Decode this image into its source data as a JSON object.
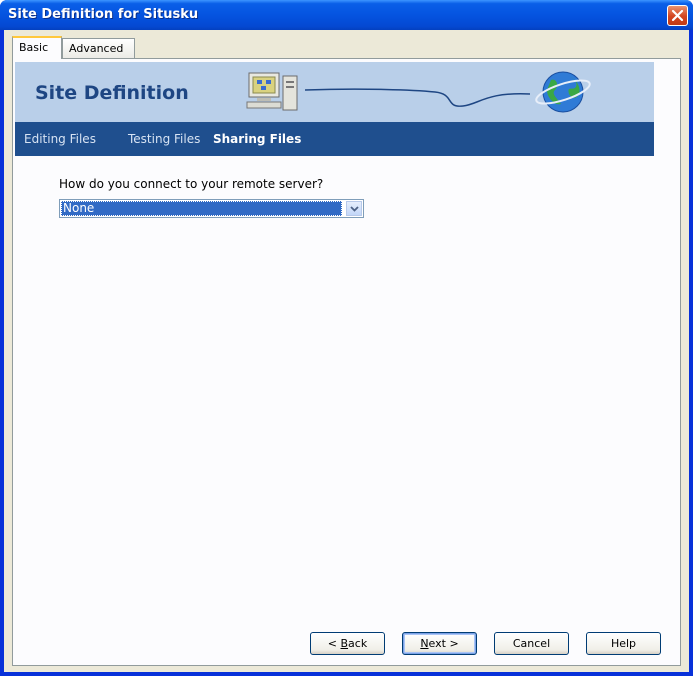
{
  "window": {
    "title": "Site Definition for Situsku"
  },
  "tabs": [
    {
      "label": "Basic"
    },
    {
      "label": "Advanced"
    }
  ],
  "banner": {
    "title": "Site Definition"
  },
  "subnav": {
    "items": [
      {
        "label": "Editing Files"
      },
      {
        "label": "Testing Files"
      },
      {
        "label": "Sharing Files"
      }
    ],
    "active": "Sharing Files"
  },
  "form": {
    "question": "How do you connect to your remote server?",
    "connection_value": "None"
  },
  "buttons": {
    "back": {
      "prefix": "< ",
      "mnemonic": "B",
      "rest": "ack"
    },
    "next": {
      "mnemonic": "N",
      "rest": "ext >"
    },
    "cancel": "Cancel",
    "help": "Help"
  },
  "colors": {
    "title_bar": "#0554e0",
    "banner_bg": "#b9cfe9",
    "banner_title": "#1e4683",
    "subnav_bg": "#1f4f8e",
    "selection": "#316ac5"
  },
  "icons": [
    "close-icon",
    "computer-icon",
    "globe-icon",
    "chevron-down-icon"
  ]
}
